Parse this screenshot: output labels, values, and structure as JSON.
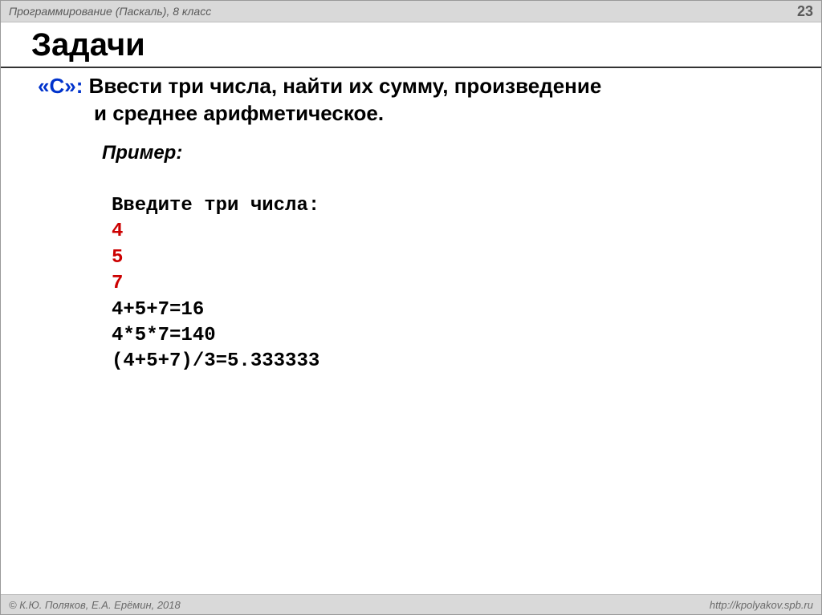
{
  "header": {
    "course": "Программирование (Паскаль), 8 класс",
    "page_number": "23"
  },
  "title": "Задачи",
  "task": {
    "label": "«С»:",
    "text_line1": " Ввести три числа, найти их сумму, произведение",
    "text_line2": "и среднее арифметическое."
  },
  "example": {
    "label": "Пример:",
    "prompt": "Введите три числа:",
    "inputs": [
      "4",
      "5",
      "7"
    ],
    "outputs": [
      "4+5+7=16",
      "4*5*7=140",
      "(4+5+7)/3=5.333333"
    ]
  },
  "footer": {
    "copyright": "© К.Ю. Поляков, Е.А. Ерёмин, 2018",
    "url": "http://kpolyakov.spb.ru"
  }
}
